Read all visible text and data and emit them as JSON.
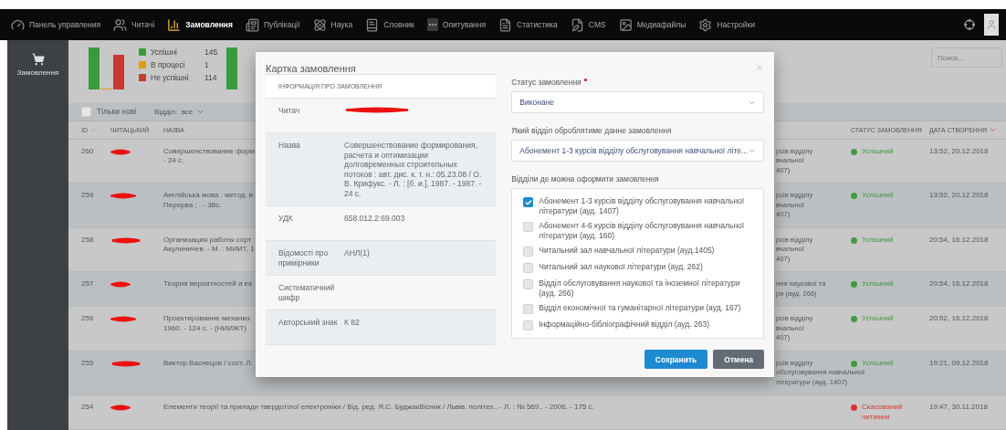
{
  "nav": {
    "items": [
      {
        "label": "Панель управления",
        "selected": false
      },
      {
        "label": "Читачі",
        "selected": false
      },
      {
        "label": "Замовлення",
        "selected": true
      },
      {
        "label": "Публікації",
        "selected": false
      },
      {
        "label": "Наука",
        "selected": false
      },
      {
        "label": "Словник",
        "selected": false
      },
      {
        "label": "Опитування",
        "selected": false
      },
      {
        "label": "Статистика",
        "selected": false
      },
      {
        "label": "CMS",
        "selected": false
      },
      {
        "label": "Медиафайлы",
        "selected": false
      },
      {
        "label": "Настройки",
        "selected": false
      }
    ]
  },
  "sidebar": {
    "items": [
      {
        "label": "Замовлення",
        "selected": true
      }
    ]
  },
  "stats": {
    "legend": [
      {
        "label": "Успішні",
        "count": "145",
        "color": "#3a9a3e"
      },
      {
        "label": "В процесі",
        "count": "1",
        "color": "#d9a010"
      },
      {
        "label": "Не успішні",
        "count": "114",
        "color": "#c83a30"
      }
    ]
  },
  "search": {
    "placeholder": "Поиск..."
  },
  "filters": {
    "only_new": {
      "label": "Тільки нові",
      "checked": false
    },
    "department": {
      "label": "Відділ:",
      "value": "все"
    }
  },
  "table": {
    "columns": [
      {
        "label": "ID",
        "sortable": true,
        "sorted": false
      },
      {
        "label": "ЧИТАЦЬКИЙ",
        "sortable": false
      },
      {
        "label": "НАЗВА",
        "sortable": false
      },
      {
        "label": "СТАТУС ЗАМОВЛЕННЯ",
        "sortable": false
      },
      {
        "label": "ДАТА СТВОРЕННЯ",
        "sortable": true,
        "sorted": true
      }
    ],
    "rows": [
      {
        "id": "260",
        "title_lines": [
          "Совершенствование форм",
          "- 24 с."
        ],
        "department_lines": [
          "рсів відділу",
          "вчальної",
          "407)"
        ],
        "status": {
          "label": "Успішний",
          "kind": "success"
        },
        "created": "13:52, 20.12.2018"
      },
      {
        "id": "259",
        "title_lines": [
          "Англійська мова : метод. в",
          "Перерва ; . - 38с."
        ],
        "department_lines": [
          "рсів відділу",
          "вчальної",
          "407)"
        ],
        "status": {
          "label": "Успішний",
          "kind": "success"
        },
        "created": "13:52, 20.12.2018"
      },
      {
        "id": "258",
        "title_lines": [
          "Организация работы сорт",
          "Акулиничев. - М. : МИИТ, 1"
        ],
        "department_lines": [
          "рсів відділу",
          "вчальної",
          "407)"
        ],
        "status": {
          "label": "Успішний",
          "kind": "success"
        },
        "created": "20:54, 16.12.2018"
      },
      {
        "id": "257",
        "title_lines": [
          "Теория вероятностей и ее"
        ],
        "department_lines": [
          "ння наукової та",
          "ри (ауд. 266)"
        ],
        "status": {
          "label": "Успішний",
          "kind": "success"
        },
        "created": "20:54, 16.12.2018"
      },
      {
        "id": "256",
        "title_lines": [
          "Проектирование механиз",
          "1960. - 124 с. - (НИИЖТ)"
        ],
        "department_lines": [
          "рсів відділу",
          "вчальної",
          "407)"
        ],
        "status": {
          "label": "Успішний",
          "kind": "success"
        },
        "created": "20:52, 16.12.2018"
      },
      {
        "id": "255",
        "title_lines": [
          "Виктор Васнецов / сост. Л."
        ],
        "department_lines": [
          "рсів відділу",
          "обслуговування навчальної",
          "літератури (ауд. 1407)"
        ],
        "status": {
          "label": "Успішний",
          "kind": "success"
        },
        "created": "19:21, 09.12.2018"
      },
      {
        "id": "254",
        "title_lines": [
          "Елементи теорії та прилади твердотілої електроніки / Від. ред. Я.С. БуджакВісник / Львів. політех.. - Л. : № 569.. - 2006. - 175 с."
        ],
        "status": {
          "label": "Скасований читачем",
          "kind": "cancelled"
        },
        "created": "19:47, 30.11.2018"
      }
    ]
  },
  "modal": {
    "title": "Картка замовлення",
    "info": {
      "heading": "ІНФОРМАЦІЯ ПРО ЗАМОВЛЕННЯ",
      "rows": [
        {
          "label": "Читач",
          "kind": "redacted"
        },
        {
          "label": "Назва",
          "kind": "text",
          "value": "Совершенствование формирования, расчета и оптимизации долговременных строительных потоков : авт. дис. к. т. н.: 05.23.08 / О. В. Крифукс. - Л. : [б. и.], 1987. - 1987. - 24 с."
        },
        {
          "label": "УДК",
          "kind": "text",
          "value": "658.012.2:69.003"
        },
        {
          "label": "Відомості про примірники",
          "kind": "text",
          "value": "АНЛ(1)"
        },
        {
          "label": "Систематичний шифр",
          "kind": "empty"
        },
        {
          "label": "Авторський знак",
          "kind": "text",
          "value": "К 82"
        }
      ]
    },
    "form": {
      "status": {
        "label": "Статус замовлення",
        "required": true,
        "value": "Виконане"
      },
      "department": {
        "label": "Який відділ оброблятиме данне замовлення",
        "value": "Абонемент 1-3 курсів відділу обслуговування навчальної літе..."
      },
      "departments": {
        "label": "Відділи де можна оформити замовлення",
        "options": [
          {
            "label": "Абонемент 1-3 курсів відділу обслуговування навчальної літератури (ауд. 1407)",
            "checked": true
          },
          {
            "label": "Абонемент 4-6 курсів відділу обслуговування навчальної літератури (ауд. 160)",
            "checked": false
          },
          {
            "label": "Читальний зал навчальної літератури (ауд.1405)",
            "checked": false
          },
          {
            "label": "Читальний зал наукової літератури (ауд. 262)",
            "checked": false
          },
          {
            "label": "Відділ обслуговування наукової та іноземної літератури (ауд. 266)",
            "checked": false
          },
          {
            "label": "Відділ економічної та гуманітарної літератури (ауд. 167)",
            "checked": false
          },
          {
            "label": "Інформаційно-бібліографічний відділ (ауд. 263)",
            "checked": false
          }
        ]
      }
    },
    "buttons": [
      {
        "label": "Сохранить",
        "kind": "primary"
      },
      {
        "label": "Отмена",
        "kind": "secondary"
      }
    ]
  }
}
